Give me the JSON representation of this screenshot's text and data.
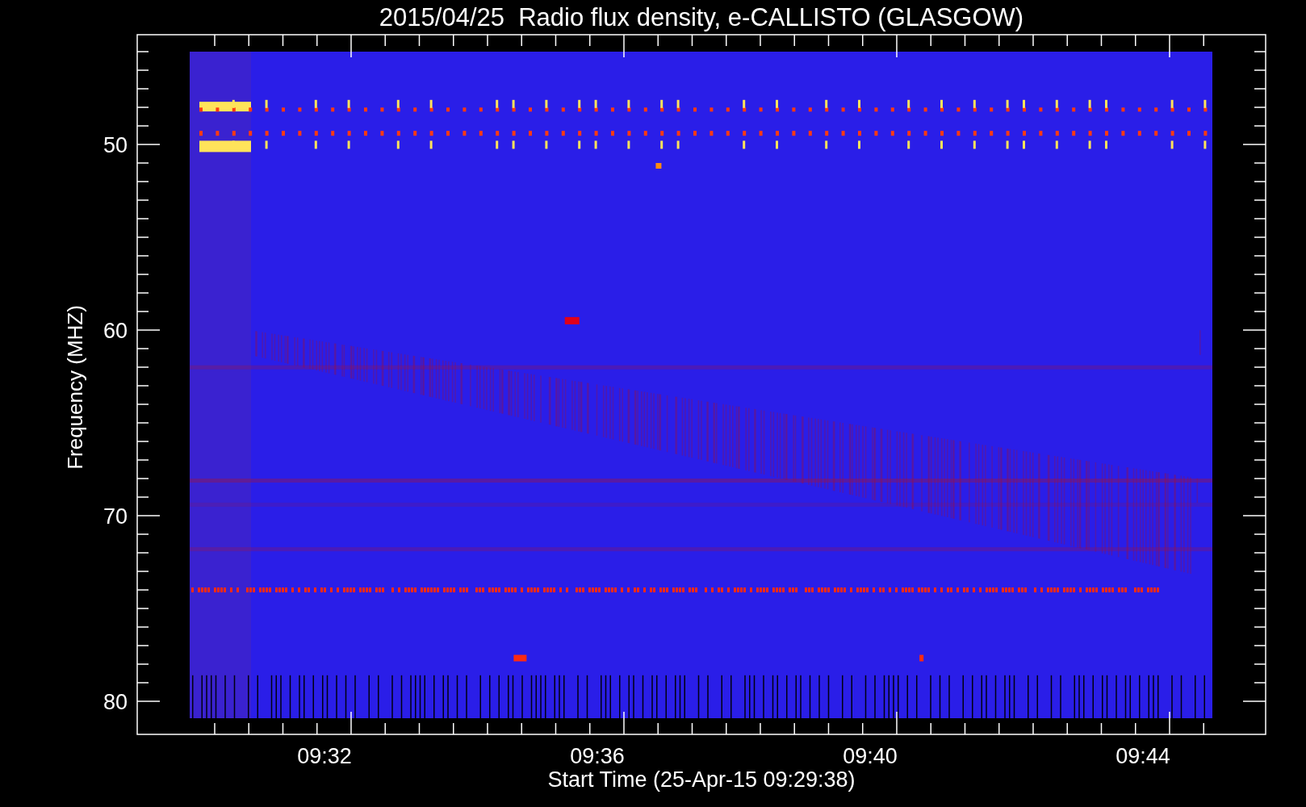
{
  "title": "2015/04/25  Radio flux density, e-CALLISTO (GLASGOW)",
  "y_axis": {
    "label": "Frequency (MHZ)",
    "ticks": [
      "50",
      "60",
      "70",
      "80"
    ]
  },
  "x_axis": {
    "label": "Start Time (25-Apr-15 09:29:38)",
    "ticks": [
      "09:32",
      "09:36",
      "09:40",
      "09:44"
    ]
  }
}
